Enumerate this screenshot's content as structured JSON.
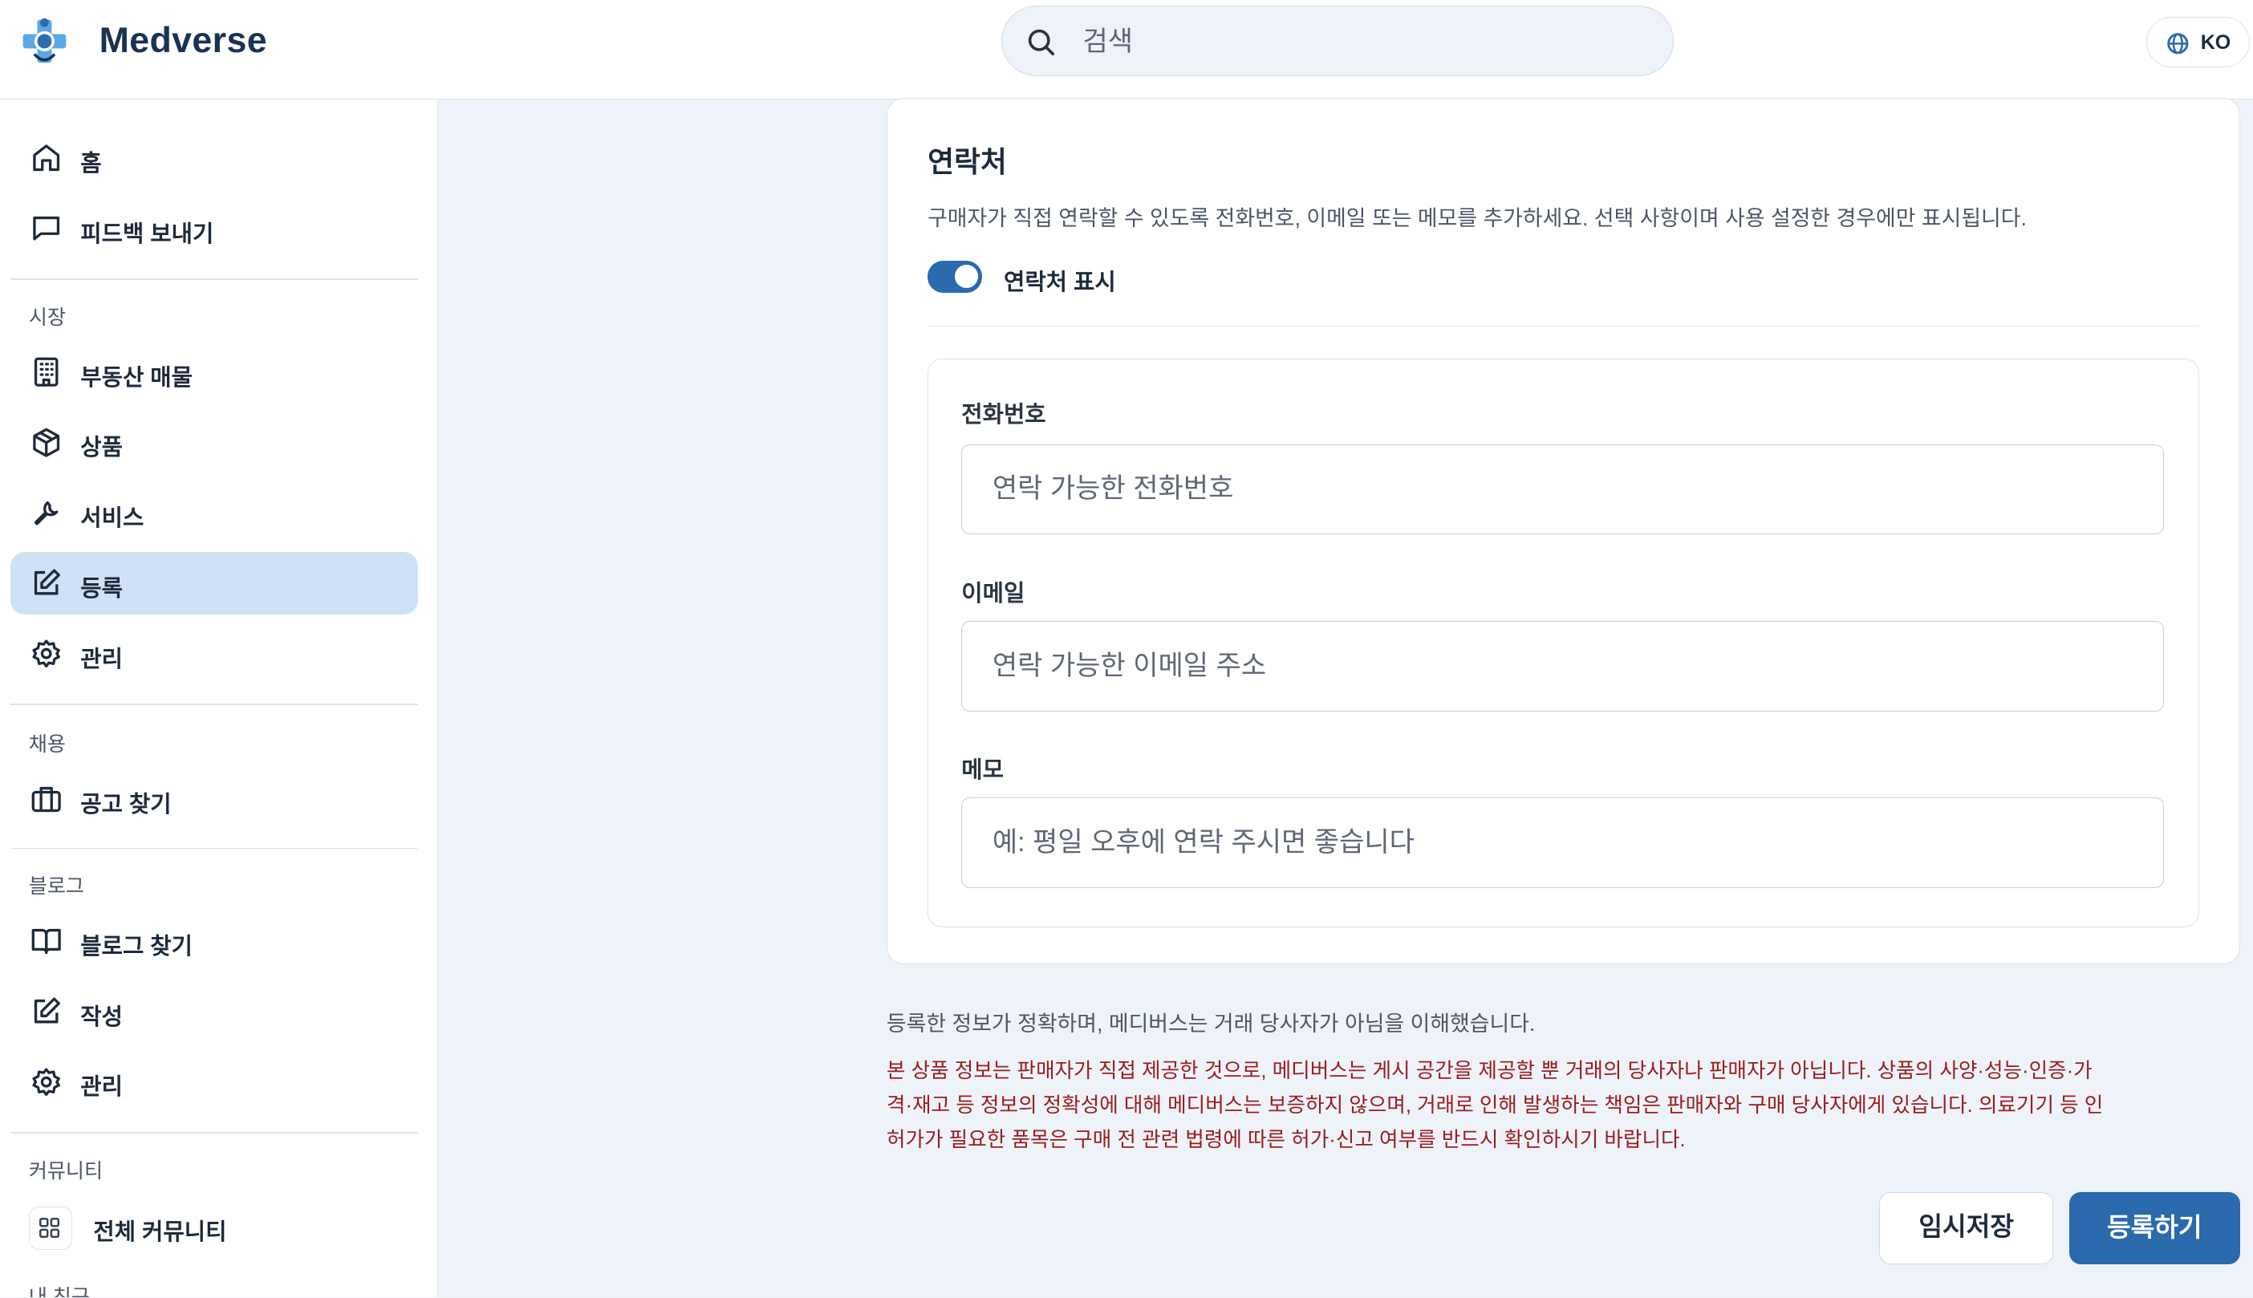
{
  "header": {
    "brand": "Medverse",
    "search_placeholder": "검색",
    "language": "KO"
  },
  "sidebar": {
    "top_items": [
      {
        "label": "홈",
        "icon": "home-icon"
      },
      {
        "label": "피드백 보내기",
        "icon": "message-square-icon"
      }
    ],
    "sections": [
      {
        "title": "시장",
        "items": [
          {
            "label": "부동산 매물",
            "icon": "building-icon"
          },
          {
            "label": "상품",
            "icon": "package-icon"
          },
          {
            "label": "서비스",
            "icon": "wrench-icon"
          },
          {
            "label": "등록",
            "icon": "edit-icon",
            "active": true
          },
          {
            "label": "관리",
            "icon": "settings-icon"
          }
        ]
      },
      {
        "title": "채용",
        "items": [
          {
            "label": "공고 찾기",
            "icon": "briefcase-icon"
          }
        ]
      },
      {
        "title": "블로그",
        "items": [
          {
            "label": "블로그 찾기",
            "icon": "book-open-icon"
          },
          {
            "label": "작성",
            "icon": "edit-icon"
          },
          {
            "label": "관리",
            "icon": "settings-icon"
          }
        ]
      },
      {
        "title": "커뮤니티",
        "items": [
          {
            "label": "전체 커뮤니티",
            "icon": "grid-icon"
          }
        ]
      },
      {
        "title": "내 친구",
        "items": []
      }
    ]
  },
  "contact": {
    "title": "연락처",
    "description": "구매자가 직접 연락할 수 있도록 전화번호, 이메일 또는 메모를 추가하세요. 선택 사항이며 사용 설정한 경우에만 표시됩니다.",
    "toggle_label": "연락처 표시",
    "toggle_on": true,
    "fields": {
      "phone": {
        "label": "전화번호",
        "placeholder": "연락 가능한 전화번호",
        "value": ""
      },
      "email": {
        "label": "이메일",
        "placeholder": "연락 가능한 이메일 주소",
        "value": ""
      },
      "memo": {
        "label": "메모",
        "placeholder": "예: 평일 오후에 연락 주시면 좋습니다",
        "value": ""
      }
    }
  },
  "agreement": "등록한 정보가 정확하며, 메디버스는 거래 당사자가 아님을 이해했습니다.",
  "disclaimer": {
    "line1": "본 상품 정보는 판매자가 직접 제공한 것으로, 메디버스는 게시 공간을 제공할 뿐 거래의 당사자나 판매자가 아닙니다. 상품의 사양·성능·인증·가",
    "line2": "격·재고 등 정보의 정확성에 대해 메디버스는 보증하지 않으며, 거래로 인해 발생하는 책임은 판매자와 구매 당사자에게 있습니다. 의료기기 등 인",
    "line3": "허가가 필요한 품목은 구매 전 관련 법령에 따른 허가·신고 여부를 반드시 확인하시기 바랍니다."
  },
  "actions": {
    "draft_label": "임시저장",
    "submit_label": "등록하기"
  },
  "colors": {
    "accent": "#2a6aad",
    "active_nav_bg": "#cfe1f5",
    "page_bg": "#eef3f9",
    "warning_text": "#9a1c1c"
  }
}
